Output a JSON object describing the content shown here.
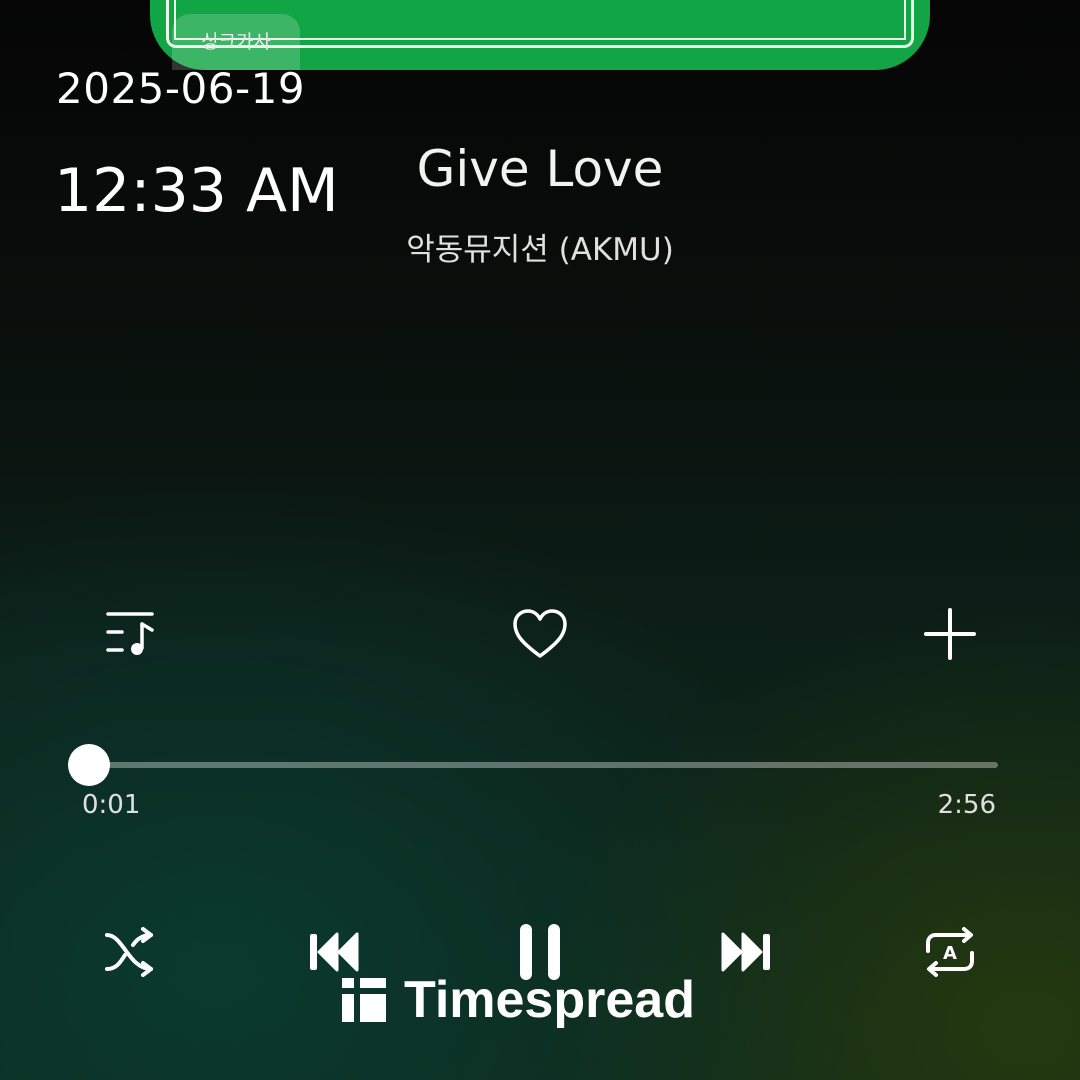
{
  "overlay": {
    "date": "2025-06-19",
    "time": "12:33 AM",
    "watermark": "Timespread"
  },
  "player": {
    "sync_lyrics_label": "싱크가사",
    "track_title": "Give Love",
    "artist": "악동뮤지션 (AKMU)",
    "elapsed": "0:01",
    "duration": "2:56",
    "progress_fraction": 0.006,
    "is_playing": true
  },
  "colors": {
    "album_green": "#12a546",
    "text": "#ffffff"
  },
  "icons": {
    "playlist": "playlist-icon",
    "like": "heart-icon",
    "add": "plus-icon",
    "shuffle": "shuffle-icon",
    "previous": "previous-icon",
    "pause": "pause-icon",
    "next": "next-icon",
    "repeat": "repeat-icon"
  }
}
